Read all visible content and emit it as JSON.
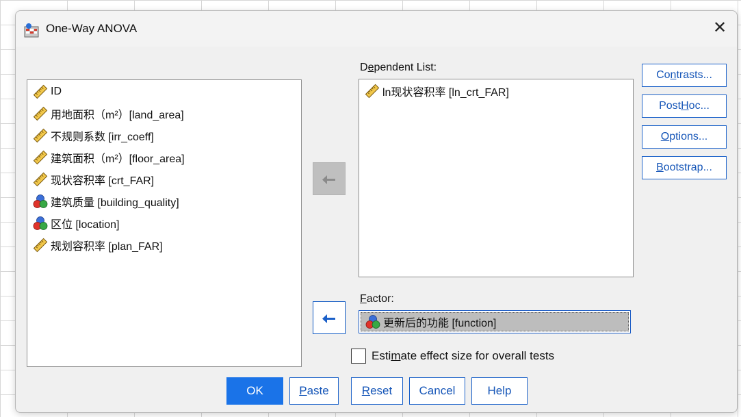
{
  "window": {
    "title": "One-Way ANOVA",
    "close_symbol": "✕"
  },
  "variables": [
    {
      "label": "ID",
      "icon": "ruler-icon"
    },
    {
      "label": "用地面积（m²）[land_area]",
      "icon": "ruler-icon"
    },
    {
      "label": "不规则系数 [irr_coeff]",
      "icon": "ruler-icon"
    },
    {
      "label": "建筑面积（m²）[floor_area]",
      "icon": "ruler-icon"
    },
    {
      "label": "现状容积率 [crt_FAR]",
      "icon": "ruler-icon"
    },
    {
      "label": "建筑质量 [building_quality]",
      "icon": "nominal-icon"
    },
    {
      "label": "区位 [location]",
      "icon": "nominal-icon"
    },
    {
      "label": "规划容积率 [plan_FAR]",
      "icon": "ruler-icon"
    }
  ],
  "dependent_list": {
    "label_pre": "D",
    "label_mnemonic": "e",
    "label_post": "pendent List:",
    "items": [
      {
        "label": "ln现状容积率 [ln_crt_FAR]",
        "icon": "ruler-icon"
      }
    ]
  },
  "factor": {
    "label_mnemonic": "F",
    "label_post": "actor:",
    "value": "更新后的功能 [function]",
    "icon": "nominal-icon"
  },
  "side_buttons": {
    "contrasts": {
      "pre": "Co",
      "mn": "n",
      "post": "trasts..."
    },
    "post_hoc": {
      "pre": "Post ",
      "mn": "H",
      "post": "oc..."
    },
    "options": {
      "pre": "",
      "mn": "O",
      "post": "ptions..."
    },
    "bootstrap": {
      "pre": "",
      "mn": "B",
      "post": "ootstrap..."
    }
  },
  "estimate_checkbox": {
    "pre": "Esti",
    "mn": "m",
    "post": "ate effect size for overall tests",
    "checked": false
  },
  "bottom_buttons": {
    "ok": "OK",
    "paste": {
      "mn": "P",
      "post": "aste"
    },
    "reset": {
      "mn": "R",
      "post": "eset"
    },
    "cancel": "Cancel",
    "help": "Help"
  },
  "colors": {
    "accent": "#1a73e8",
    "link_blue": "#1656b8",
    "selection_gray": "#bdbdbd"
  }
}
